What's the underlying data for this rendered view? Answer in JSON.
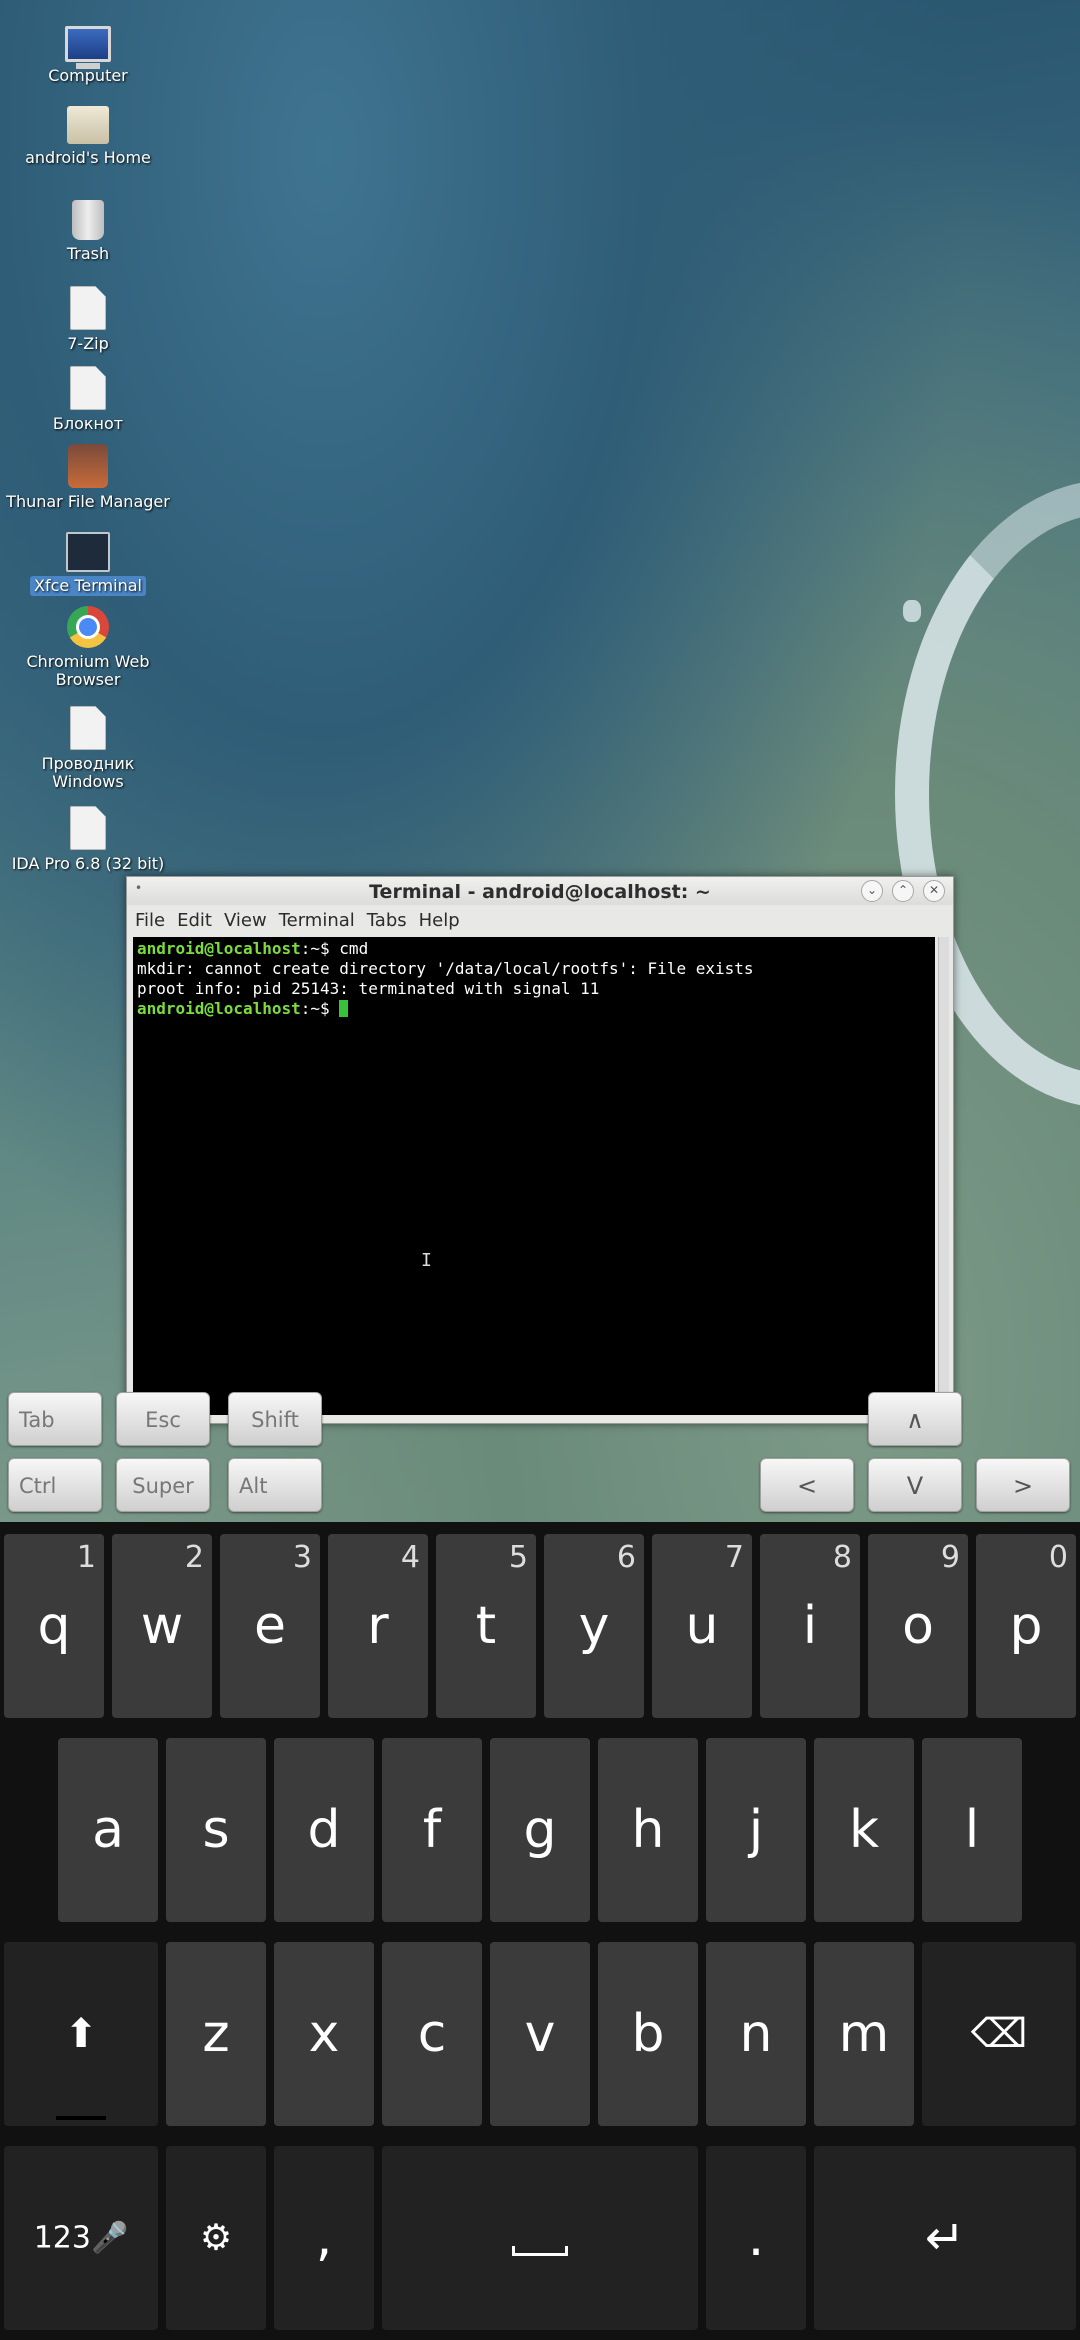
{
  "desktop": {
    "icons": [
      {
        "label": "Computer",
        "glyph": "monitor"
      },
      {
        "label": "android's Home",
        "glyph": "home"
      },
      {
        "label": "Trash",
        "glyph": "trash"
      },
      {
        "label": "7-Zip",
        "glyph": "file"
      },
      {
        "label": "Блокнот",
        "glyph": "file"
      },
      {
        "label": "Thunar File Manager",
        "glyph": "thunar"
      },
      {
        "label": "Xfce Terminal",
        "glyph": "term",
        "selected": true
      },
      {
        "label": "Chromium Web Browser",
        "glyph": "chrome"
      },
      {
        "label": "Проводник Windows",
        "glyph": "file"
      },
      {
        "label": "IDA Pro 6.8 (32 bit)",
        "glyph": "file"
      }
    ]
  },
  "terminal": {
    "title": "Terminal - android@localhost: ~",
    "menu": [
      "File",
      "Edit",
      "View",
      "Terminal",
      "Tabs",
      "Help"
    ],
    "lines": [
      {
        "prompt": "android@localhost",
        "path": ":~$ ",
        "text": "cmd"
      },
      {
        "text": "mkdir: cannot create directory '/data/local/rootfs': File exists"
      },
      {
        "text": "proot info: pid 25143: terminated with signal 11"
      },
      {
        "prompt": "android@localhost",
        "path": ":~$ ",
        "text": ""
      }
    ],
    "window_buttons": [
      "minimize-icon",
      "maximize-icon",
      "close-icon"
    ]
  },
  "extra_keys": {
    "row1": [
      "Tab",
      "Esc",
      "Shift"
    ],
    "row2": [
      "Ctrl",
      "Super",
      "Alt"
    ],
    "arrows": {
      "up": "∧",
      "left": "<",
      "down": "V",
      "right": ">"
    }
  },
  "keyboard": {
    "row1": [
      {
        "ch": "q",
        "num": "1"
      },
      {
        "ch": "w",
        "num": "2"
      },
      {
        "ch": "e",
        "num": "3"
      },
      {
        "ch": "r",
        "num": "4"
      },
      {
        "ch": "t",
        "num": "5"
      },
      {
        "ch": "y",
        "num": "6"
      },
      {
        "ch": "u",
        "num": "7"
      },
      {
        "ch": "i",
        "num": "8"
      },
      {
        "ch": "o",
        "num": "9"
      },
      {
        "ch": "p",
        "num": "0"
      }
    ],
    "row2": [
      "a",
      "s",
      "d",
      "f",
      "g",
      "h",
      "j",
      "k",
      "l"
    ],
    "row3": [
      "z",
      "x",
      "c",
      "v",
      "b",
      "n",
      "m"
    ],
    "symbols_label": "123",
    "comma": ",",
    "period": "."
  }
}
